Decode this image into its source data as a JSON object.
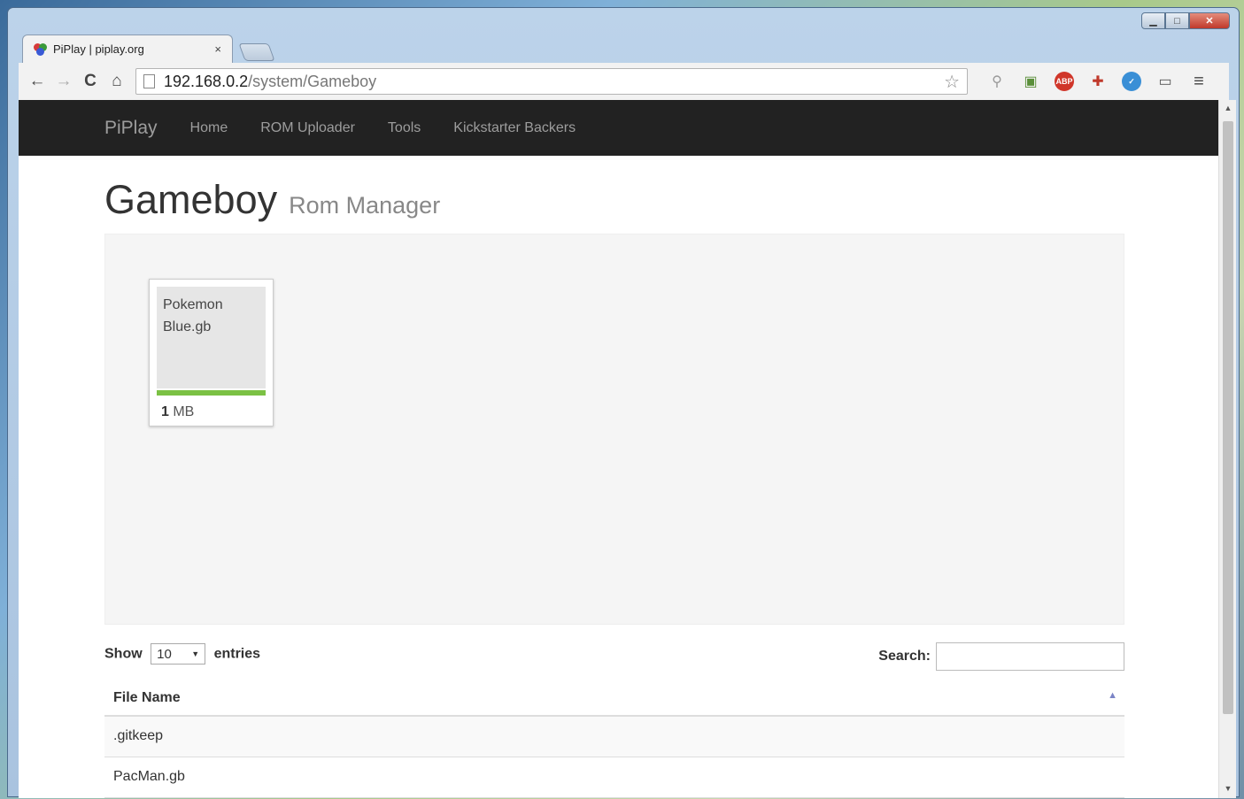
{
  "browser": {
    "tab_title": "PiPlay | piplay.org",
    "tab_close": "×",
    "url_host": "192.168.0.2",
    "url_path": "/system/Gameboy",
    "window_controls": {
      "minimize": "▁",
      "maximize": "□",
      "close": "✕"
    },
    "nav": {
      "back": "←",
      "forward": "→",
      "reload": "C",
      "home": "⌂"
    },
    "bookmark_star": "☆",
    "extensions": [
      "search-ext-icon",
      "clipboard-ext-icon",
      "adblock-ext-icon",
      "puzzle-ext-icon",
      "check-ext-icon",
      "cast-icon",
      "menu-icon"
    ],
    "adblock_label": "ABP"
  },
  "navbar": {
    "brand": "PiPlay",
    "links": [
      "Home",
      "ROM Uploader",
      "Tools",
      "Kickstarter Backers"
    ]
  },
  "header": {
    "title": "Gameboy",
    "subtitle": "Rom Manager"
  },
  "rom_card": {
    "name_line1": "Pokemon",
    "name_line2": "Blue.gb",
    "size_value": "1",
    "size_unit": " MB",
    "progress": 1.0
  },
  "table_controls": {
    "show_label": "Show",
    "entries_value": "10",
    "entries_label": "entries",
    "search_label": "Search:",
    "search_value": ""
  },
  "table": {
    "column": "File Name",
    "sort_indicator": "▲",
    "rows": [
      ".gitkeep",
      "PacMan.gb"
    ]
  },
  "colors": {
    "navbar_bg": "#222222",
    "progress": "#7bc144",
    "sort_arrow": "#7b84c6"
  }
}
